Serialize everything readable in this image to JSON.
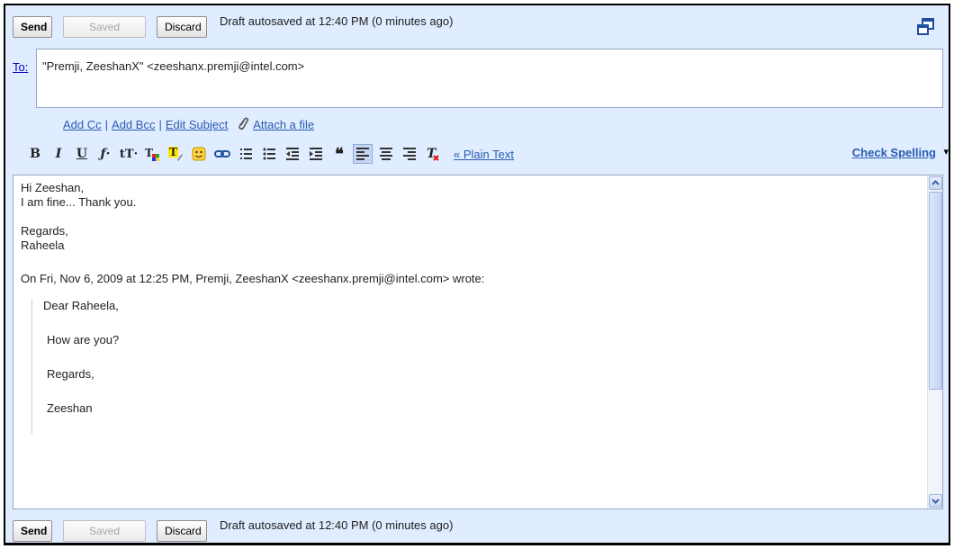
{
  "buttons": {
    "send": "Send",
    "saved": "Saved",
    "discard": "Discard"
  },
  "status": "Draft autosaved at 12:40 PM (0 minutes ago)",
  "to": {
    "label": "To:",
    "value": "\"Premji, ZeeshanX\" <zeeshanx.premji@intel.com>"
  },
  "links": {
    "add_cc": "Add Cc",
    "add_bcc": "Add Bcc",
    "edit_subject": "Edit Subject",
    "attach": "Attach a file",
    "sep": "|"
  },
  "toolbar": {
    "plain_text": "« Plain Text",
    "check_spelling": "Check Spelling",
    "arrow": "▾"
  },
  "body": {
    "greeting": "Hi Zeeshan,",
    "line2": "I am fine... Thank you.",
    "sign1": "Regards,",
    "sign2": "Raheela",
    "quote_header": "On Fri, Nov 6, 2009 at 12:25 PM, Premji, ZeeshanX <zeeshanx.premji@intel.com> wrote:",
    "quote": [
      "Dear Raheela,",
      "How are you?",
      "Regards,",
      "Zeeshan"
    ]
  }
}
